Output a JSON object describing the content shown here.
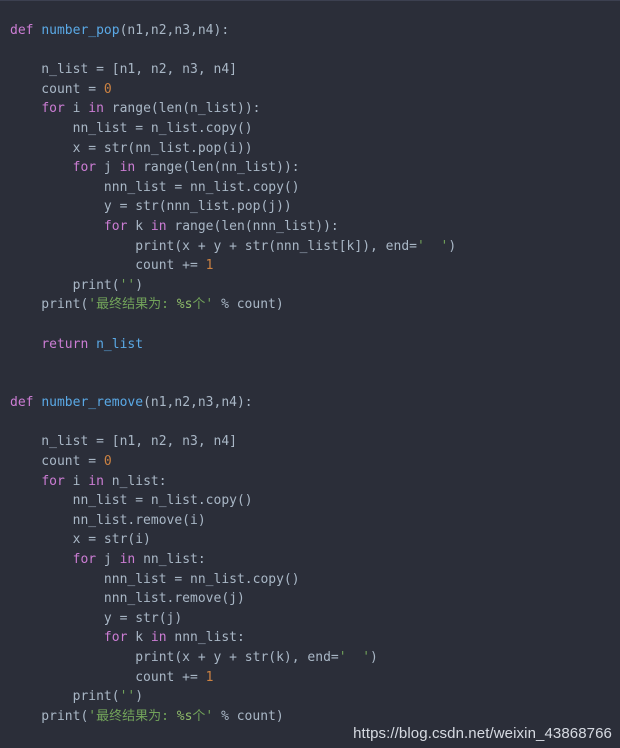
{
  "editor": {
    "background_color": "#2b2e39",
    "default_text_color": "#a9b7c6",
    "language": "python",
    "font_size_px": 13,
    "line_height_px": 19.6
  },
  "palette": {
    "keyword": "#cc7dd4",
    "function_name": "#5aa9e6",
    "identifier": "#a9b7c6",
    "number": "#cc8242",
    "string": "#72a35a",
    "format_spec": "#8fbc6a",
    "watermark": "#dfe3ea"
  },
  "watermark": {
    "text": "https://blog.csdn.net/weixin_43868766"
  },
  "code": {
    "lines": [
      [
        {
          "t": "def ",
          "c": "kw"
        },
        {
          "t": "number_pop",
          "c": "fn"
        },
        {
          "t": "(n1,n2,n3,n4):",
          "c": "nm"
        }
      ],
      [],
      [
        {
          "t": "    n_list = [n1, n2, n3, n4]",
          "c": "nm"
        }
      ],
      [
        {
          "t": "    count = ",
          "c": "nm"
        },
        {
          "t": "0",
          "c": "num"
        }
      ],
      [
        {
          "t": "    ",
          "c": "nm"
        },
        {
          "t": "for",
          "c": "kw"
        },
        {
          "t": " i ",
          "c": "nm"
        },
        {
          "t": "in",
          "c": "kw"
        },
        {
          "t": " range(len(n_list)):",
          "c": "nm"
        }
      ],
      [
        {
          "t": "        nn_list = n_list.copy()",
          "c": "nm"
        }
      ],
      [
        {
          "t": "        x = str(nn_list.pop(i))",
          "c": "nm"
        }
      ],
      [
        {
          "t": "        ",
          "c": "nm"
        },
        {
          "t": "for",
          "c": "kw"
        },
        {
          "t": " j ",
          "c": "nm"
        },
        {
          "t": "in",
          "c": "kw"
        },
        {
          "t": " range(len(nn_list)):",
          "c": "nm"
        }
      ],
      [
        {
          "t": "            nnn_list = nn_list.copy()",
          "c": "nm"
        }
      ],
      [
        {
          "t": "            y = str(nnn_list.pop(j))",
          "c": "nm"
        }
      ],
      [
        {
          "t": "            ",
          "c": "nm"
        },
        {
          "t": "for",
          "c": "kw"
        },
        {
          "t": " k ",
          "c": "nm"
        },
        {
          "t": "in",
          "c": "kw"
        },
        {
          "t": " range(len(nnn_list)):",
          "c": "nm"
        }
      ],
      [
        {
          "t": "                print(x + y + str(nnn_list[k]), end=",
          "c": "nm"
        },
        {
          "t": "'  '",
          "c": "str"
        },
        {
          "t": ")",
          "c": "nm"
        }
      ],
      [
        {
          "t": "                count += ",
          "c": "nm"
        },
        {
          "t": "1",
          "c": "num"
        }
      ],
      [
        {
          "t": "        print(",
          "c": "nm"
        },
        {
          "t": "''",
          "c": "str"
        },
        {
          "t": ")",
          "c": "nm"
        }
      ],
      [
        {
          "t": "    print(",
          "c": "nm"
        },
        {
          "t": "'最终结果为: ",
          "c": "str"
        },
        {
          "t": "%s",
          "c": "fmt"
        },
        {
          "t": "个'",
          "c": "str"
        },
        {
          "t": " % count)",
          "c": "nm"
        }
      ],
      [],
      [
        {
          "t": "    ",
          "c": "nm"
        },
        {
          "t": "return",
          "c": "kw"
        },
        {
          "t": " n_list",
          "c": "fn"
        }
      ],
      [],
      [],
      [
        {
          "t": "def ",
          "c": "kw"
        },
        {
          "t": "number_remove",
          "c": "fn"
        },
        {
          "t": "(n1,n2,n3,n4):",
          "c": "nm"
        }
      ],
      [],
      [
        {
          "t": "    n_list = [n1, n2, n3, n4]",
          "c": "nm"
        }
      ],
      [
        {
          "t": "    count = ",
          "c": "nm"
        },
        {
          "t": "0",
          "c": "num"
        }
      ],
      [
        {
          "t": "    ",
          "c": "nm"
        },
        {
          "t": "for",
          "c": "kw"
        },
        {
          "t": " i ",
          "c": "nm"
        },
        {
          "t": "in",
          "c": "kw"
        },
        {
          "t": " n_list:",
          "c": "nm"
        }
      ],
      [
        {
          "t": "        nn_list = n_list.copy()",
          "c": "nm"
        }
      ],
      [
        {
          "t": "        nn_list.remove(i)",
          "c": "nm"
        }
      ],
      [
        {
          "t": "        x = str(i)",
          "c": "nm"
        }
      ],
      [
        {
          "t": "        ",
          "c": "nm"
        },
        {
          "t": "for",
          "c": "kw"
        },
        {
          "t": " j ",
          "c": "nm"
        },
        {
          "t": "in",
          "c": "kw"
        },
        {
          "t": " nn_list:",
          "c": "nm"
        }
      ],
      [
        {
          "t": "            nnn_list = nn_list.copy()",
          "c": "nm"
        }
      ],
      [
        {
          "t": "            nnn_list.remove(j)",
          "c": "nm"
        }
      ],
      [
        {
          "t": "            y = str(j)",
          "c": "nm"
        }
      ],
      [
        {
          "t": "            ",
          "c": "nm"
        },
        {
          "t": "for",
          "c": "kw"
        },
        {
          "t": " k ",
          "c": "nm"
        },
        {
          "t": "in",
          "c": "kw"
        },
        {
          "t": " nnn_list:",
          "c": "nm"
        }
      ],
      [
        {
          "t": "                print(x + y + str(k), end=",
          "c": "nm"
        },
        {
          "t": "'  '",
          "c": "str"
        },
        {
          "t": ")",
          "c": "nm"
        }
      ],
      [
        {
          "t": "                count += ",
          "c": "nm"
        },
        {
          "t": "1",
          "c": "num"
        }
      ],
      [
        {
          "t": "        print(",
          "c": "nm"
        },
        {
          "t": "''",
          "c": "str"
        },
        {
          "t": ")",
          "c": "nm"
        }
      ],
      [
        {
          "t": "    print(",
          "c": "nm"
        },
        {
          "t": "'最终结果为: ",
          "c": "str"
        },
        {
          "t": "%s",
          "c": "fmt"
        },
        {
          "t": "个'",
          "c": "str"
        },
        {
          "t": " % count)",
          "c": "nm"
        }
      ]
    ]
  }
}
